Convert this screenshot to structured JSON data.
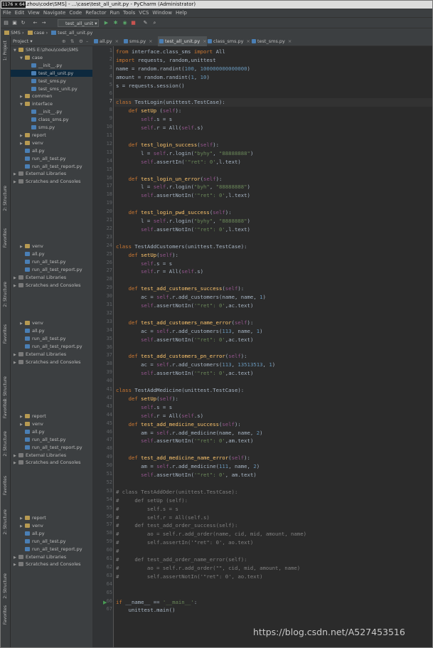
{
  "window": {
    "size_badge": "1176 × 64",
    "title": "...zhou\\code\\SMS] - ...\\case\\test_all_unit.py - PyCharm (Administrator)"
  },
  "menu": [
    "File",
    "Edit",
    "View",
    "Navigate",
    "Code",
    "Refactor",
    "Run",
    "Tools",
    "VCS",
    "Window",
    "Help"
  ],
  "toolbar": {
    "run_config": "test_all_unit"
  },
  "breadcrumb": [
    "SMS",
    "case",
    "test_all_unit.py"
  ],
  "project_panel": {
    "header": "Project",
    "tree": [
      {
        "label": "SMS  E:\\zhou\\code\\SMS",
        "type": "folder",
        "depth": 0,
        "open": true
      },
      {
        "label": "case",
        "type": "folder",
        "depth": 1,
        "open": true
      },
      {
        "label": "__init__.py",
        "type": "py",
        "depth": 2
      },
      {
        "label": "test_all_unit.py",
        "type": "py",
        "depth": 2,
        "selected": true
      },
      {
        "label": "test_sms.py",
        "type": "py",
        "depth": 2
      },
      {
        "label": "test_sms_unit.py",
        "type": "py",
        "depth": 2
      },
      {
        "label": "commen",
        "type": "folder",
        "depth": 1,
        "open": false
      },
      {
        "label": "interface",
        "type": "folder",
        "depth": 1,
        "open": true
      },
      {
        "label": "__init__.py",
        "type": "py",
        "depth": 2
      },
      {
        "label": "class_sms.py",
        "type": "py",
        "depth": 2
      },
      {
        "label": "sms.py",
        "type": "py",
        "depth": 2
      },
      {
        "label": "report",
        "type": "folder",
        "depth": 1,
        "open": false
      },
      {
        "label": "venv",
        "type": "folder",
        "depth": 1,
        "open": false
      },
      {
        "label": "all.py",
        "type": "py",
        "depth": 1
      },
      {
        "label": "run_all_test.py",
        "type": "py",
        "depth": 1
      },
      {
        "label": "run_all_test_report.py",
        "type": "py",
        "depth": 1
      },
      {
        "label": "External Libraries",
        "type": "lib",
        "depth": 0
      },
      {
        "label": "Scratches and Consoles",
        "type": "lib",
        "depth": 0
      }
    ],
    "ghost_blocks": [
      [
        {
          "label": "venv",
          "type": "folder",
          "depth": 1
        },
        {
          "label": "all.py",
          "type": "py",
          "depth": 1
        },
        {
          "label": "run_all_test.py",
          "type": "py",
          "depth": 1
        },
        {
          "label": "run_all_test_report.py",
          "type": "py",
          "depth": 1
        },
        {
          "label": "External Libraries",
          "type": "lib",
          "depth": 0
        },
        {
          "label": "Scratches and Consoles",
          "type": "lib",
          "depth": 0
        }
      ],
      [
        {
          "label": "venv",
          "type": "folder",
          "depth": 1
        },
        {
          "label": "all.py",
          "type": "py",
          "depth": 1
        },
        {
          "label": "run_all_test.py",
          "type": "py",
          "depth": 1
        },
        {
          "label": "run_all_test_report.py",
          "type": "py",
          "depth": 1
        },
        {
          "label": "External Libraries",
          "type": "lib",
          "depth": 0
        },
        {
          "label": "Scratches and Consoles",
          "type": "lib",
          "depth": 0
        }
      ],
      [
        {
          "label": "report",
          "type": "folder",
          "depth": 1
        },
        {
          "label": "venv",
          "type": "folder",
          "depth": 1
        },
        {
          "label": "all.py",
          "type": "py",
          "depth": 1
        },
        {
          "label": "run_all_test.py",
          "type": "py",
          "depth": 1
        },
        {
          "label": "run_all_test_report.py",
          "type": "py",
          "depth": 1
        },
        {
          "label": "External Libraries",
          "type": "lib",
          "depth": 0
        },
        {
          "label": "Scratches and Consoles",
          "type": "lib",
          "depth": 0
        }
      ],
      [
        {
          "label": "report",
          "type": "folder",
          "depth": 1
        },
        {
          "label": "venv",
          "type": "folder",
          "depth": 1
        },
        {
          "label": "all.py",
          "type": "py",
          "depth": 1
        },
        {
          "label": "run_all_test.py",
          "type": "py",
          "depth": 1
        },
        {
          "label": "run_all_test_report.py",
          "type": "py",
          "depth": 1
        },
        {
          "label": "External Libraries",
          "type": "lib",
          "depth": 0
        },
        {
          "label": "Scratches and Consoles",
          "type": "lib",
          "depth": 0
        }
      ]
    ]
  },
  "side_tabs": [
    "1: Project",
    "2: Structure",
    "Favorites"
  ],
  "editor_tabs": [
    {
      "label": "all.py",
      "active": false
    },
    {
      "label": "sms.py",
      "active": false
    },
    {
      "label": "test_all_unit.py",
      "active": true
    },
    {
      "label": "class_sms.py",
      "active": false
    },
    {
      "label": "test_sms.py",
      "active": false
    }
  ],
  "current_line": 7,
  "code": [
    [
      [
        "k",
        "from "
      ],
      [
        "",
        "interface.class_sms "
      ],
      [
        "k",
        "import "
      ],
      [
        "",
        "All"
      ]
    ],
    [
      [
        "k",
        "import "
      ],
      [
        "",
        "requests, random,unittest"
      ]
    ],
    [
      [
        "",
        "name = random.randint("
      ],
      [
        "n",
        "100"
      ],
      [
        "",
        ", "
      ],
      [
        "n",
        "100000000000000"
      ],
      [
        "",
        ")"
      ]
    ],
    [
      [
        "",
        "amount = random.randint("
      ],
      [
        "n",
        "1"
      ],
      [
        "",
        ", "
      ],
      [
        "n",
        "10"
      ],
      [
        "",
        ")"
      ]
    ],
    [
      [
        "",
        "s = requests.session()"
      ]
    ],
    [],
    [
      [
        "k",
        "class "
      ],
      [
        "",
        "TestLogin(unittest.TestCase):"
      ]
    ],
    [
      [
        "",
        "    "
      ],
      [
        "k",
        "def "
      ],
      [
        "f",
        "setUp"
      ],
      [
        "",
        " ("
      ],
      [
        "sf",
        "self"
      ],
      [
        "",
        "):"
      ]
    ],
    [
      [
        "",
        "        "
      ],
      [
        "sf",
        "self"
      ],
      [
        "",
        ".s = s"
      ]
    ],
    [
      [
        "",
        "        "
      ],
      [
        "sf",
        "self"
      ],
      [
        "",
        ".r = All("
      ],
      [
        "sf",
        "self"
      ],
      [
        "",
        ".s)"
      ]
    ],
    [],
    [
      [
        "",
        "    "
      ],
      [
        "k",
        "def "
      ],
      [
        "f",
        "test_login_success"
      ],
      [
        "",
        "("
      ],
      [
        "sf",
        "self"
      ],
      [
        "",
        "):"
      ]
    ],
    [
      [
        "",
        "        l = "
      ],
      [
        "sf",
        "self"
      ],
      [
        "",
        ".r.login("
      ],
      [
        "s",
        "\"byhy\""
      ],
      [
        "",
        ", "
      ],
      [
        "s",
        "\"88888888\""
      ],
      [
        "",
        ")"
      ]
    ],
    [
      [
        "",
        "        "
      ],
      [
        "sf",
        "self"
      ],
      [
        "",
        ".assertIn("
      ],
      [
        "s",
        "'\"ret\": 0'"
      ],
      [
        "",
        ",l.text)"
      ]
    ],
    [],
    [
      [
        "",
        "    "
      ],
      [
        "k",
        "def "
      ],
      [
        "f",
        "test_login_un_error"
      ],
      [
        "",
        "("
      ],
      [
        "sf",
        "self"
      ],
      [
        "",
        "):"
      ]
    ],
    [
      [
        "",
        "        l = "
      ],
      [
        "sf",
        "self"
      ],
      [
        "",
        ".r.login("
      ],
      [
        "s",
        "\"byh\""
      ],
      [
        "",
        ", "
      ],
      [
        "s",
        "\"88888888\""
      ],
      [
        "",
        ")"
      ]
    ],
    [
      [
        "",
        "        "
      ],
      [
        "sf",
        "self"
      ],
      [
        "",
        ".assertNotIn("
      ],
      [
        "s",
        "'\"ret\": 0'"
      ],
      [
        "",
        ",l.text)"
      ]
    ],
    [],
    [
      [
        "",
        "    "
      ],
      [
        "k",
        "def "
      ],
      [
        "f",
        "test_login_pwd_success"
      ],
      [
        "",
        "("
      ],
      [
        "sf",
        "self"
      ],
      [
        "",
        "):"
      ]
    ],
    [
      [
        "",
        "        l = "
      ],
      [
        "sf",
        "self"
      ],
      [
        "",
        ".r.login("
      ],
      [
        "s",
        "\"byhy\""
      ],
      [
        "",
        ", "
      ],
      [
        "s",
        "\"8888888\""
      ],
      [
        "",
        ")"
      ]
    ],
    [
      [
        "",
        "        "
      ],
      [
        "sf",
        "self"
      ],
      [
        "",
        ".assertNotIn("
      ],
      [
        "s",
        "'\"ret\": 0'"
      ],
      [
        "",
        ",l.text)"
      ]
    ],
    [],
    [
      [
        "k",
        "class "
      ],
      [
        "",
        "TestAddCustomers(unittest.TestCase):"
      ]
    ],
    [
      [
        "",
        "    "
      ],
      [
        "k",
        "def "
      ],
      [
        "f",
        "setUp"
      ],
      [
        "",
        "("
      ],
      [
        "sf",
        "self"
      ],
      [
        "",
        "):"
      ]
    ],
    [
      [
        "",
        "        "
      ],
      [
        "sf",
        "self"
      ],
      [
        "",
        ".s = s"
      ]
    ],
    [
      [
        "",
        "        "
      ],
      [
        "sf",
        "self"
      ],
      [
        "",
        ".r = All("
      ],
      [
        "sf",
        "self"
      ],
      [
        "",
        ".s)"
      ]
    ],
    [],
    [
      [
        "",
        "    "
      ],
      [
        "k",
        "def "
      ],
      [
        "f",
        "test_add_customers_success"
      ],
      [
        "",
        "("
      ],
      [
        "sf",
        "self"
      ],
      [
        "",
        "):"
      ]
    ],
    [
      [
        "",
        "        ac = "
      ],
      [
        "sf",
        "self"
      ],
      [
        "",
        ".r.add_customers(name, name, "
      ],
      [
        "n",
        "1"
      ],
      [
        "",
        ")"
      ]
    ],
    [
      [
        "",
        "        "
      ],
      [
        "sf",
        "self"
      ],
      [
        "",
        ".assertNotIn("
      ],
      [
        "s",
        "'\"ret\": 0'"
      ],
      [
        "",
        ",ac.text)"
      ]
    ],
    [],
    [
      [
        "",
        "    "
      ],
      [
        "k",
        "def "
      ],
      [
        "f",
        "test_add_customers_name_error"
      ],
      [
        "",
        "("
      ],
      [
        "sf",
        "self"
      ],
      [
        "",
        "):"
      ]
    ],
    [
      [
        "",
        "        ac = "
      ],
      [
        "sf",
        "self"
      ],
      [
        "",
        ".r.add_customers("
      ],
      [
        "n",
        "113"
      ],
      [
        "",
        ", name, "
      ],
      [
        "n",
        "1"
      ],
      [
        "",
        ")"
      ]
    ],
    [
      [
        "",
        "        "
      ],
      [
        "sf",
        "self"
      ],
      [
        "",
        ".assertNotIn("
      ],
      [
        "s",
        "'\"ret\": 0'"
      ],
      [
        "",
        ",ac.text)"
      ]
    ],
    [],
    [
      [
        "",
        "    "
      ],
      [
        "k",
        "def "
      ],
      [
        "f",
        "test_add_customers_pn_error"
      ],
      [
        "",
        "("
      ],
      [
        "sf",
        "self"
      ],
      [
        "",
        "):"
      ]
    ],
    [
      [
        "",
        "        ac = "
      ],
      [
        "sf",
        "self"
      ],
      [
        "",
        ".r.add_customers("
      ],
      [
        "n",
        "113"
      ],
      [
        "",
        ", "
      ],
      [
        "n",
        "13513513"
      ],
      [
        "",
        ", "
      ],
      [
        "n",
        "1"
      ],
      [
        "",
        ")"
      ]
    ],
    [
      [
        "",
        "        "
      ],
      [
        "sf",
        "self"
      ],
      [
        "",
        ".assertNotIn("
      ],
      [
        "s",
        "'\"ret\": 0'"
      ],
      [
        "",
        ",ac.text)"
      ]
    ],
    [],
    [
      [
        "k",
        "class "
      ],
      [
        "",
        "TestAddMedicine(unittest.TestCase):"
      ]
    ],
    [
      [
        "",
        "    "
      ],
      [
        "k",
        "def "
      ],
      [
        "f",
        "setUp"
      ],
      [
        "",
        "("
      ],
      [
        "sf",
        "self"
      ],
      [
        "",
        "):"
      ]
    ],
    [
      [
        "",
        "        "
      ],
      [
        "sf",
        "self"
      ],
      [
        "",
        ".s = s"
      ]
    ],
    [
      [
        "",
        "        "
      ],
      [
        "sf",
        "self"
      ],
      [
        "",
        ".r = All("
      ],
      [
        "sf",
        "self"
      ],
      [
        "",
        ".s)"
      ]
    ],
    [
      [
        "",
        "    "
      ],
      [
        "k",
        "def "
      ],
      [
        "f",
        "test_add_medicine_success"
      ],
      [
        "",
        "("
      ],
      [
        "sf",
        "self"
      ],
      [
        "",
        "):"
      ]
    ],
    [
      [
        "",
        "        am = "
      ],
      [
        "sf",
        "self"
      ],
      [
        "",
        ".r.add_medicine(name, name, "
      ],
      [
        "n",
        "2"
      ],
      [
        "",
        ")"
      ]
    ],
    [
      [
        "",
        "        "
      ],
      [
        "sf",
        "self"
      ],
      [
        "",
        ".assertNotIn("
      ],
      [
        "s",
        "'\"ret\": 0'"
      ],
      [
        "",
        ",am.text)"
      ]
    ],
    [],
    [
      [
        "",
        "    "
      ],
      [
        "k",
        "def "
      ],
      [
        "f",
        "test_add_medicine_name_error"
      ],
      [
        "",
        "("
      ],
      [
        "sf",
        "self"
      ],
      [
        "",
        "):"
      ]
    ],
    [
      [
        "",
        "        am = "
      ],
      [
        "sf",
        "self"
      ],
      [
        "",
        ".r.add_medicine("
      ],
      [
        "n",
        "111"
      ],
      [
        "",
        ", name, "
      ],
      [
        "n",
        "2"
      ],
      [
        "",
        ")"
      ]
    ],
    [
      [
        "",
        "        "
      ],
      [
        "sf",
        "self"
      ],
      [
        "",
        ".assertNotIn("
      ],
      [
        "s",
        "'\"ret\": 0'"
      ],
      [
        "",
        ", am.text)"
      ]
    ],
    [],
    [
      [
        "c",
        "# class TestAddOder(unittest.TestCase):"
      ]
    ],
    [
      [
        "c",
        "#     def setUp (self):"
      ]
    ],
    [
      [
        "c",
        "#         self.s = s"
      ]
    ],
    [
      [
        "c",
        "#         self.r = All(self.s)"
      ]
    ],
    [
      [
        "c",
        "#     def test_add_order_success(self):"
      ]
    ],
    [
      [
        "c",
        "#         ao = self.r.add_order(name, cid, mid, amount, name)"
      ]
    ],
    [
      [
        "c",
        "#         self.assertIn('\"ret\": 0', ao.text)"
      ]
    ],
    [
      [
        "c",
        "#"
      ]
    ],
    [
      [
        "c",
        "#     def test_add_order_name_error(self):"
      ]
    ],
    [
      [
        "c",
        "#         ao = self.r.add_order(\"\", cid, mid, amount, name)"
      ]
    ],
    [
      [
        "c",
        "#         self.assertNotIn('\"ret\": 0', ao.text)"
      ]
    ],
    [],
    [],
    [
      [
        "k",
        "if "
      ],
      [
        "",
        "__name__ == "
      ],
      [
        "s",
        "'__main__'"
      ],
      [
        "",
        ":"
      ]
    ],
    [
      [
        "",
        "    unittest.main()"
      ]
    ]
  ],
  "watermark": "https://blog.csdn.net/A527453516",
  "colors": {
    "bg": "#2b2b2b",
    "keyword": "#cc7832",
    "string": "#6a8759",
    "number": "#6897bb",
    "function": "#ffc66d",
    "self": "#94558d",
    "comment": "#808080"
  }
}
